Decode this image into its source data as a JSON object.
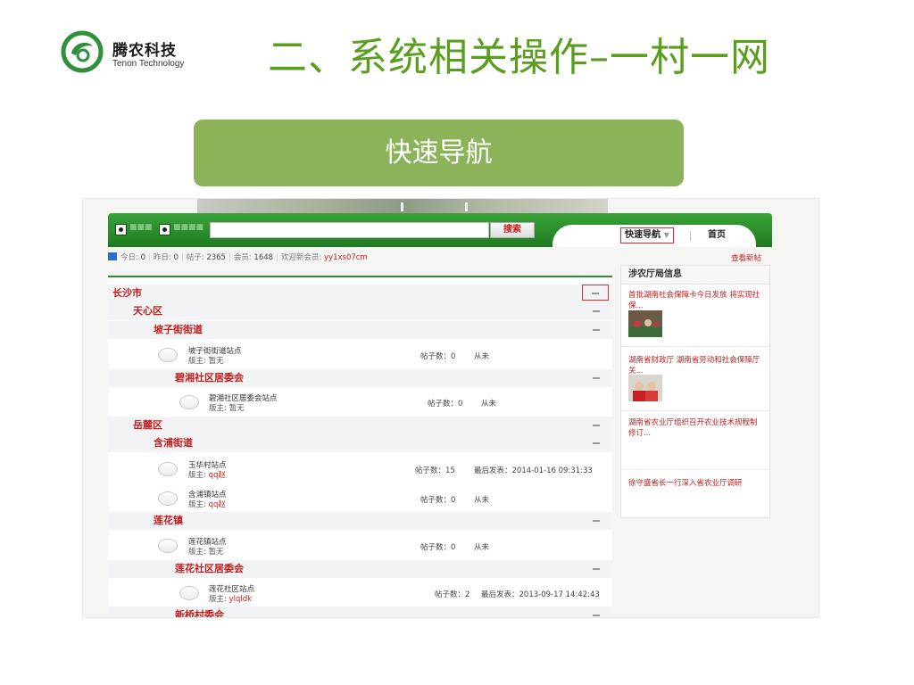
{
  "slide": {
    "logo_cn": "腾农科技",
    "logo_en": "Tenon Technology",
    "title": "二、系统相关操作–一村一网",
    "nav_banner": "快速导航"
  },
  "site": {
    "search_btn": "搜索",
    "tab_quicknav": "快速导航",
    "tab_home": "首页",
    "stats": {
      "today_label": "今日:",
      "today": "0",
      "yesterday_label": "昨日:",
      "yesterday": "0",
      "posts_label": "帖子:",
      "posts": "2365",
      "members_label": "会员:",
      "members": "1648",
      "newmember_label": "欢迎新会员:",
      "newmember": "yy1xs07cm"
    },
    "view_new": "查看新帖"
  },
  "forum": {
    "cats": [
      {
        "label": "长沙市"
      },
      {
        "label": "天心区"
      },
      {
        "label": "坡子街街道"
      },
      {
        "label": "碧湘社区居委会"
      },
      {
        "label": "岳麓区"
      },
      {
        "label": "含浦街道"
      },
      {
        "label": "莲花镇"
      },
      {
        "label": "莲花社区居委会"
      },
      {
        "label": "新桥村委会"
      }
    ],
    "boards": [
      {
        "name": "坡子街街道站点",
        "mod_label": "版主:",
        "mod": "暂无",
        "count": "帖子数：0",
        "last": "从未"
      },
      {
        "name": "碧湘社区居委会站点",
        "mod_label": "版主:",
        "mod": "暂无",
        "count": "帖子数：0",
        "last": "从未"
      },
      {
        "name": "玉华村站点",
        "mod_label": "版主:",
        "mod": "qq赵",
        "count": "帖子数：15",
        "last": "最后发表：2014-01-16 09:31:33"
      },
      {
        "name": "含浦镇站点",
        "mod_label": "版主:",
        "mod": "qq赵",
        "count": "帖子数：0",
        "last": "从未"
      },
      {
        "name": "莲花镇站点",
        "mod_label": "版主:",
        "mod": "暂无",
        "count": "帖子数：0",
        "last": "从未"
      },
      {
        "name": "莲花社区站点",
        "mod_label": "版主:",
        "mod": "ylqldk",
        "count": "帖子数：2",
        "last": "最后发表：2013-09-17 14:42:43"
      }
    ]
  },
  "sidebar": {
    "title": "涉农厅局信息",
    "items": [
      {
        "text": "首批湖南社会保障卡今日发放 将实现社保..."
      },
      {
        "text": "湖南省财政厅 湖南省劳动和社会保障厅关..."
      },
      {
        "text": "湖南省农业厅组织召开农业技术规程制修订..."
      },
      {
        "text": "徐守盛省长一行深入省农业厅调研"
      }
    ]
  },
  "colors": {
    "title_green": "#5a9e1e",
    "banner_green": "#8cb35a",
    "bar_green": "#2e8b2e",
    "link_red": "#c21d1d"
  }
}
